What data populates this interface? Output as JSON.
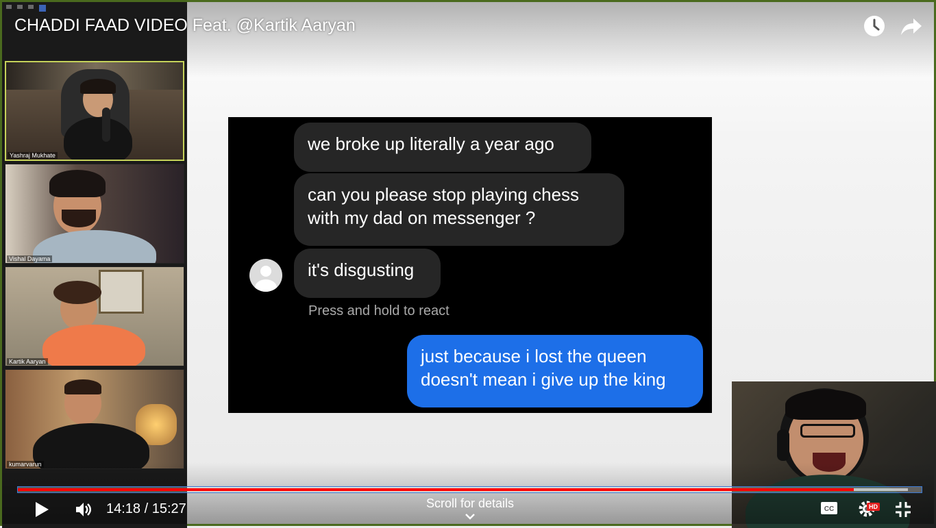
{
  "video": {
    "title": "CHADDI FAAD VIDEO Feat. @Kartik Aaryan",
    "current_time": "14:18",
    "duration": "15:27",
    "timecode": "14:18 / 15:27",
    "progress_fraction": 0.925,
    "buffered_fraction": 0.985,
    "scroll_hint": "Scroll for details",
    "hd_badge": "HD"
  },
  "icons": {
    "watch_later": "clock-icon",
    "share": "share-arrow-icon",
    "play": "play-icon",
    "volume": "volume-icon",
    "captions": "cc-icon",
    "settings": "gear-icon",
    "exit_fullscreen": "exit-fullscreen-icon",
    "scroll": "chevron-down-icon"
  },
  "participants": [
    {
      "name": "Yashraj Mukhate"
    },
    {
      "name": "Vishal Dayama"
    },
    {
      "name": "Kartik Aaryan"
    },
    {
      "name": "kumarvarun"
    }
  ],
  "chat": {
    "messages": [
      {
        "text": "we broke up literally a year ago",
        "from": "them"
      },
      {
        "text": "can you please stop playing chess with my dad on messenger ?",
        "from": "them"
      },
      {
        "text": "it's disgusting",
        "from": "them"
      },
      {
        "text": "just because i lost the queen doesn't mean i give up the king",
        "from": "me"
      }
    ],
    "react_hint": "Press and hold to react"
  },
  "colors": {
    "progress_played": "#ff0000",
    "my_bubble": "#1d6fe8",
    "their_bubble": "#262626",
    "active_tile_border": "#c6d35a"
  }
}
